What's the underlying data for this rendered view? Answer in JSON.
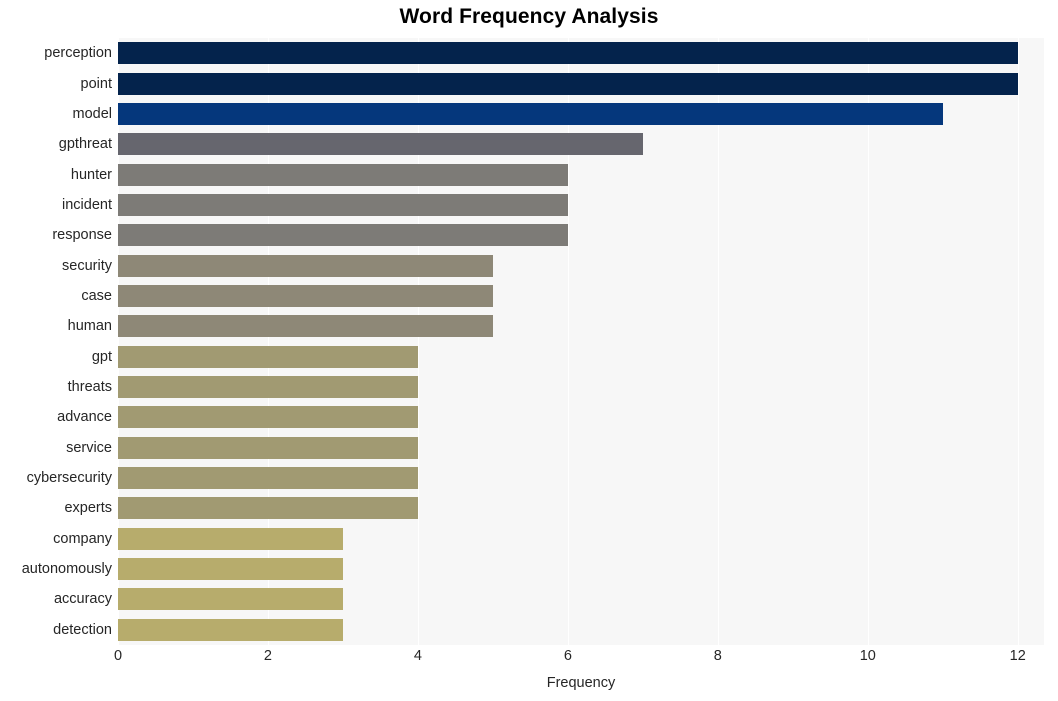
{
  "chart_data": {
    "type": "bar",
    "orientation": "horizontal",
    "title": "Word Frequency Analysis",
    "xlabel": "Frequency",
    "ylabel": "",
    "xlim": [
      0,
      12.35
    ],
    "ylim": [
      0,
      20
    ],
    "xticks": [
      0,
      2,
      4,
      6,
      8,
      10,
      12
    ],
    "xticklabels": [
      "0",
      "2",
      "4",
      "6",
      "8",
      "10",
      "12"
    ],
    "grid": "vertical-white-on-light-gray",
    "legend": "none",
    "categories": [
      "perception",
      "point",
      "model",
      "gpthreat",
      "hunter",
      "incident",
      "response",
      "security",
      "case",
      "human",
      "gpt",
      "threats",
      "advance",
      "service",
      "cybersecurity",
      "experts",
      "company",
      "autonomously",
      "accuracy",
      "detection"
    ],
    "values": [
      12,
      12,
      11,
      7,
      6,
      6,
      6,
      5,
      5,
      5,
      4,
      4,
      4,
      4,
      4,
      4,
      3,
      3,
      3,
      3
    ],
    "bar_colors": [
      "#04234c",
      "#04234c",
      "#05377c",
      "#66666e",
      "#7d7b77",
      "#7d7b77",
      "#7d7b77",
      "#8e8877",
      "#8e8877",
      "#8e8877",
      "#a19a72",
      "#a19a72",
      "#a19a72",
      "#a19a72",
      "#a19a72",
      "#a19a72",
      "#b7ac6c",
      "#b7ac6c",
      "#b7ac6c",
      "#b7ac6c"
    ],
    "plot_background": "#f7f7f7",
    "figure_background": "#ffffff",
    "tick_label_color": "#262626",
    "title_color": "#000000"
  }
}
